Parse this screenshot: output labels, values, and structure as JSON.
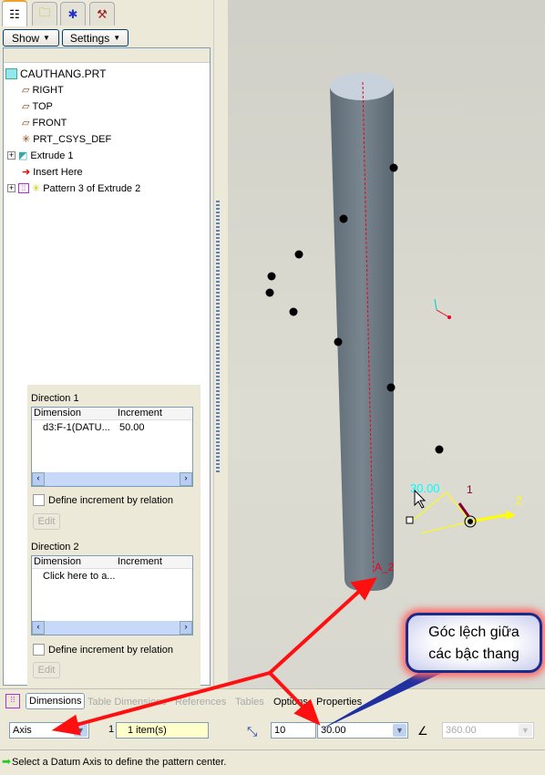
{
  "tabs": [
    {
      "icon": "model-tree-icon"
    },
    {
      "icon": "folder-browser-icon"
    },
    {
      "icon": "favorites-folder-icon"
    },
    {
      "icon": "tools-folder-icon"
    }
  ],
  "toolbar": {
    "show": "Show",
    "settings": "Settings"
  },
  "tree": {
    "root": "CAUTHANG.PRT",
    "items": [
      "RIGHT",
      "TOP",
      "FRONT",
      "PRT_CSYS_DEF",
      "Extrude 1",
      "Insert Here",
      "Pattern 3 of Extrude 2"
    ]
  },
  "direction1": {
    "title": "Direction 1",
    "col_dim": "Dimension",
    "col_inc": "Increment",
    "rows": [
      {
        "dim": "d3:F-1(DATU...",
        "inc": "50.00"
      }
    ],
    "checkbox": "Define increment by relation",
    "edit": "Edit"
  },
  "direction2": {
    "title": "Direction 2",
    "col_dim": "Dimension",
    "col_inc": "Increment",
    "placeholder": "Click here to a...",
    "checkbox": "Define increment by relation",
    "edit": "Edit"
  },
  "viewport": {
    "dim_label": "30.00",
    "axis_label": "A_2",
    "dir1": "1",
    "dir2": "2"
  },
  "dash": {
    "tabs": [
      "Dimensions",
      "Table Dimensions",
      "References",
      "Tables",
      "Options",
      "Properties"
    ],
    "type": "Axis",
    "count_label": "1",
    "items": "1 item(s)",
    "members": "10",
    "angle": "30.00",
    "total_angle": "360.00"
  },
  "status": "Select a Datum Axis to define the pattern center.",
  "callout": {
    "line1": "Góc lệch giữa",
    "line2": "các bậc thang"
  },
  "colors": {
    "accent": "#1a2a8a",
    "arrow": "#ff1010",
    "highlight": "#ffffcc"
  }
}
